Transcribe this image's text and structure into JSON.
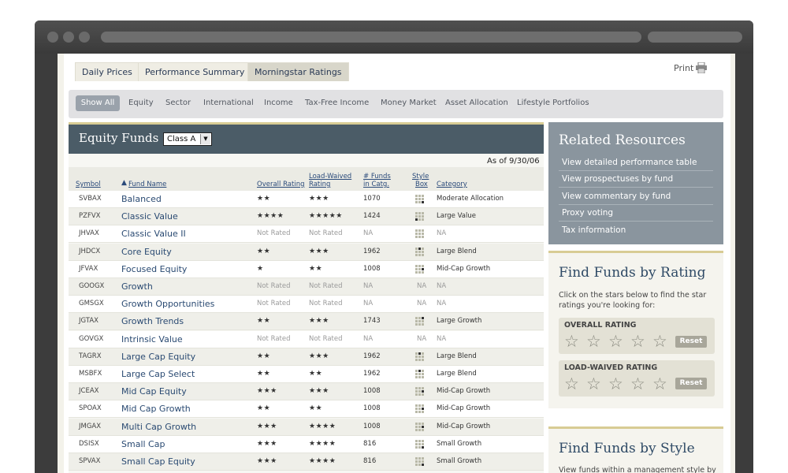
{
  "tabs": [
    {
      "label": "Daily Prices"
    },
    {
      "label": "Performance Summary"
    },
    {
      "label": "Morningstar Ratings"
    }
  ],
  "print_label": "Print",
  "subnav": [
    "Show All",
    "Equity",
    "Sector",
    "International",
    "Income",
    "Tax-Free Income",
    "Money Market",
    "Asset Allocation",
    "Lifestyle Portfolios"
  ],
  "equity": {
    "title": "Equity Funds",
    "class_select": "Class A",
    "as_of": "As of 9/30/06",
    "headers": {
      "symbol": "Symbol",
      "fund_name": "Fund Name",
      "overall": "Overall Rating",
      "load_1": "Load-Waived",
      "load_2": "Rating",
      "funds_1": "# Funds",
      "funds_2": "in Catg.",
      "style_1": "Style",
      "style_2": "Box",
      "category": "Category"
    },
    "rows": [
      {
        "symbol": "SVBAX",
        "name": "Balanced",
        "overall": "★★",
        "load": "★★★",
        "funds": "1070",
        "style": [
          0,
          0,
          0,
          0,
          0,
          0,
          0,
          0,
          1
        ],
        "category": "Moderate Allocation"
      },
      {
        "symbol": "PZFVX",
        "name": "Classic Value",
        "overall": "★★★★",
        "load": "★★★★★",
        "funds": "1424",
        "style": [
          0,
          0,
          0,
          0,
          0,
          0,
          1,
          0,
          0
        ],
        "category": "Large Value"
      },
      {
        "symbol": "JHVAX",
        "name": "Classic Value II",
        "overall": "Not Rated",
        "load": "Not Rated",
        "funds": "NA",
        "style": [
          0,
          0,
          0,
          0,
          0,
          0,
          0,
          0,
          0
        ],
        "category": "NA"
      },
      {
        "symbol": "JHDCX",
        "name": "Core Equity",
        "overall": "★★",
        "load": "★★★",
        "funds": "1962",
        "style": [
          0,
          1,
          0,
          0,
          0,
          0,
          0,
          0,
          0
        ],
        "category": "Large Blend"
      },
      {
        "symbol": "JFVAX",
        "name": "Focused Equity",
        "overall": "★",
        "load": "★★",
        "funds": "1008",
        "style": [
          0,
          0,
          0,
          0,
          0,
          1,
          0,
          0,
          0
        ],
        "category": "Mid-Cap Growth"
      },
      {
        "symbol": "GOOGX",
        "name": "Growth",
        "overall": "Not Rated",
        "load": "Not Rated",
        "funds": "NA",
        "style": null,
        "category": "NA"
      },
      {
        "symbol": "GMSGX",
        "name": "Growth Opportunities",
        "overall": "Not Rated",
        "load": "Not Rated",
        "funds": "NA",
        "style": null,
        "category": "NA"
      },
      {
        "symbol": "JGTAX",
        "name": "Growth Trends",
        "overall": "★★",
        "load": "★★★",
        "funds": "1743",
        "style": [
          0,
          0,
          1,
          0,
          0,
          0,
          0,
          0,
          0
        ],
        "category": "Large Growth"
      },
      {
        "symbol": "GOVGX",
        "name": "Intrinsic Value",
        "overall": "Not Rated",
        "load": "Not Rated",
        "funds": "NA",
        "style": null,
        "category": "NA"
      },
      {
        "symbol": "TAGRX",
        "name": "Large Cap Equity",
        "overall": "★★",
        "load": "★★★",
        "funds": "1962",
        "style": [
          0,
          1,
          0,
          0,
          0,
          0,
          0,
          0,
          0
        ],
        "category": "Large Blend"
      },
      {
        "symbol": "MSBFX",
        "name": "Large Cap Select",
        "overall": "★★",
        "load": "★★",
        "funds": "1962",
        "style": [
          0,
          1,
          0,
          0,
          0,
          0,
          0,
          0,
          0
        ],
        "category": "Large Blend"
      },
      {
        "symbol": "JCEAX",
        "name": "Mid Cap Equity",
        "overall": "★★★",
        "load": "★★★",
        "funds": "1008",
        "style": [
          0,
          0,
          0,
          0,
          0,
          1,
          0,
          0,
          0
        ],
        "category": "Mid-Cap Growth"
      },
      {
        "symbol": "SPOAX",
        "name": "Mid Cap Growth",
        "overall": "★★",
        "load": "★★",
        "funds": "1008",
        "style": [
          0,
          0,
          0,
          0,
          0,
          1,
          0,
          0,
          0
        ],
        "category": "Mid-Cap Growth"
      },
      {
        "symbol": "JMGAX",
        "name": "Multi Cap Growth",
        "overall": "★★★",
        "load": "★★★★",
        "funds": "1008",
        "style": [
          0,
          0,
          0,
          0,
          0,
          1,
          0,
          0,
          0
        ],
        "category": "Mid-Cap Growth"
      },
      {
        "symbol": "DSISX",
        "name": "Small Cap",
        "overall": "★★★",
        "load": "★★★★",
        "funds": "816",
        "style": [
          0,
          0,
          0,
          0,
          0,
          0,
          0,
          0,
          1
        ],
        "category": "Small Growth"
      },
      {
        "symbol": "SPVAX",
        "name": "Small Cap Equity",
        "overall": "★★★",
        "load": "★★★★",
        "funds": "816",
        "style": [
          0,
          0,
          0,
          0,
          0,
          0,
          0,
          0,
          1
        ],
        "category": "Small Growth"
      }
    ]
  },
  "related": {
    "title": "Related Resources",
    "links": [
      "View detailed performance table",
      "View prospectuses by fund",
      "View commentary by fund",
      "Proxy voting",
      "Tax information"
    ]
  },
  "find_rating": {
    "title": "Find Funds by Rating",
    "desc": "Click on the stars below to find the star ratings you're looking for:",
    "overall_label": "OVERALL RATING",
    "load_label": "LOAD-WAIVED RATING",
    "reset": "Reset",
    "star_glyph": "☆"
  },
  "find_style": {
    "title": "Find Funds by Style",
    "desc": "View funds within a management style by"
  }
}
